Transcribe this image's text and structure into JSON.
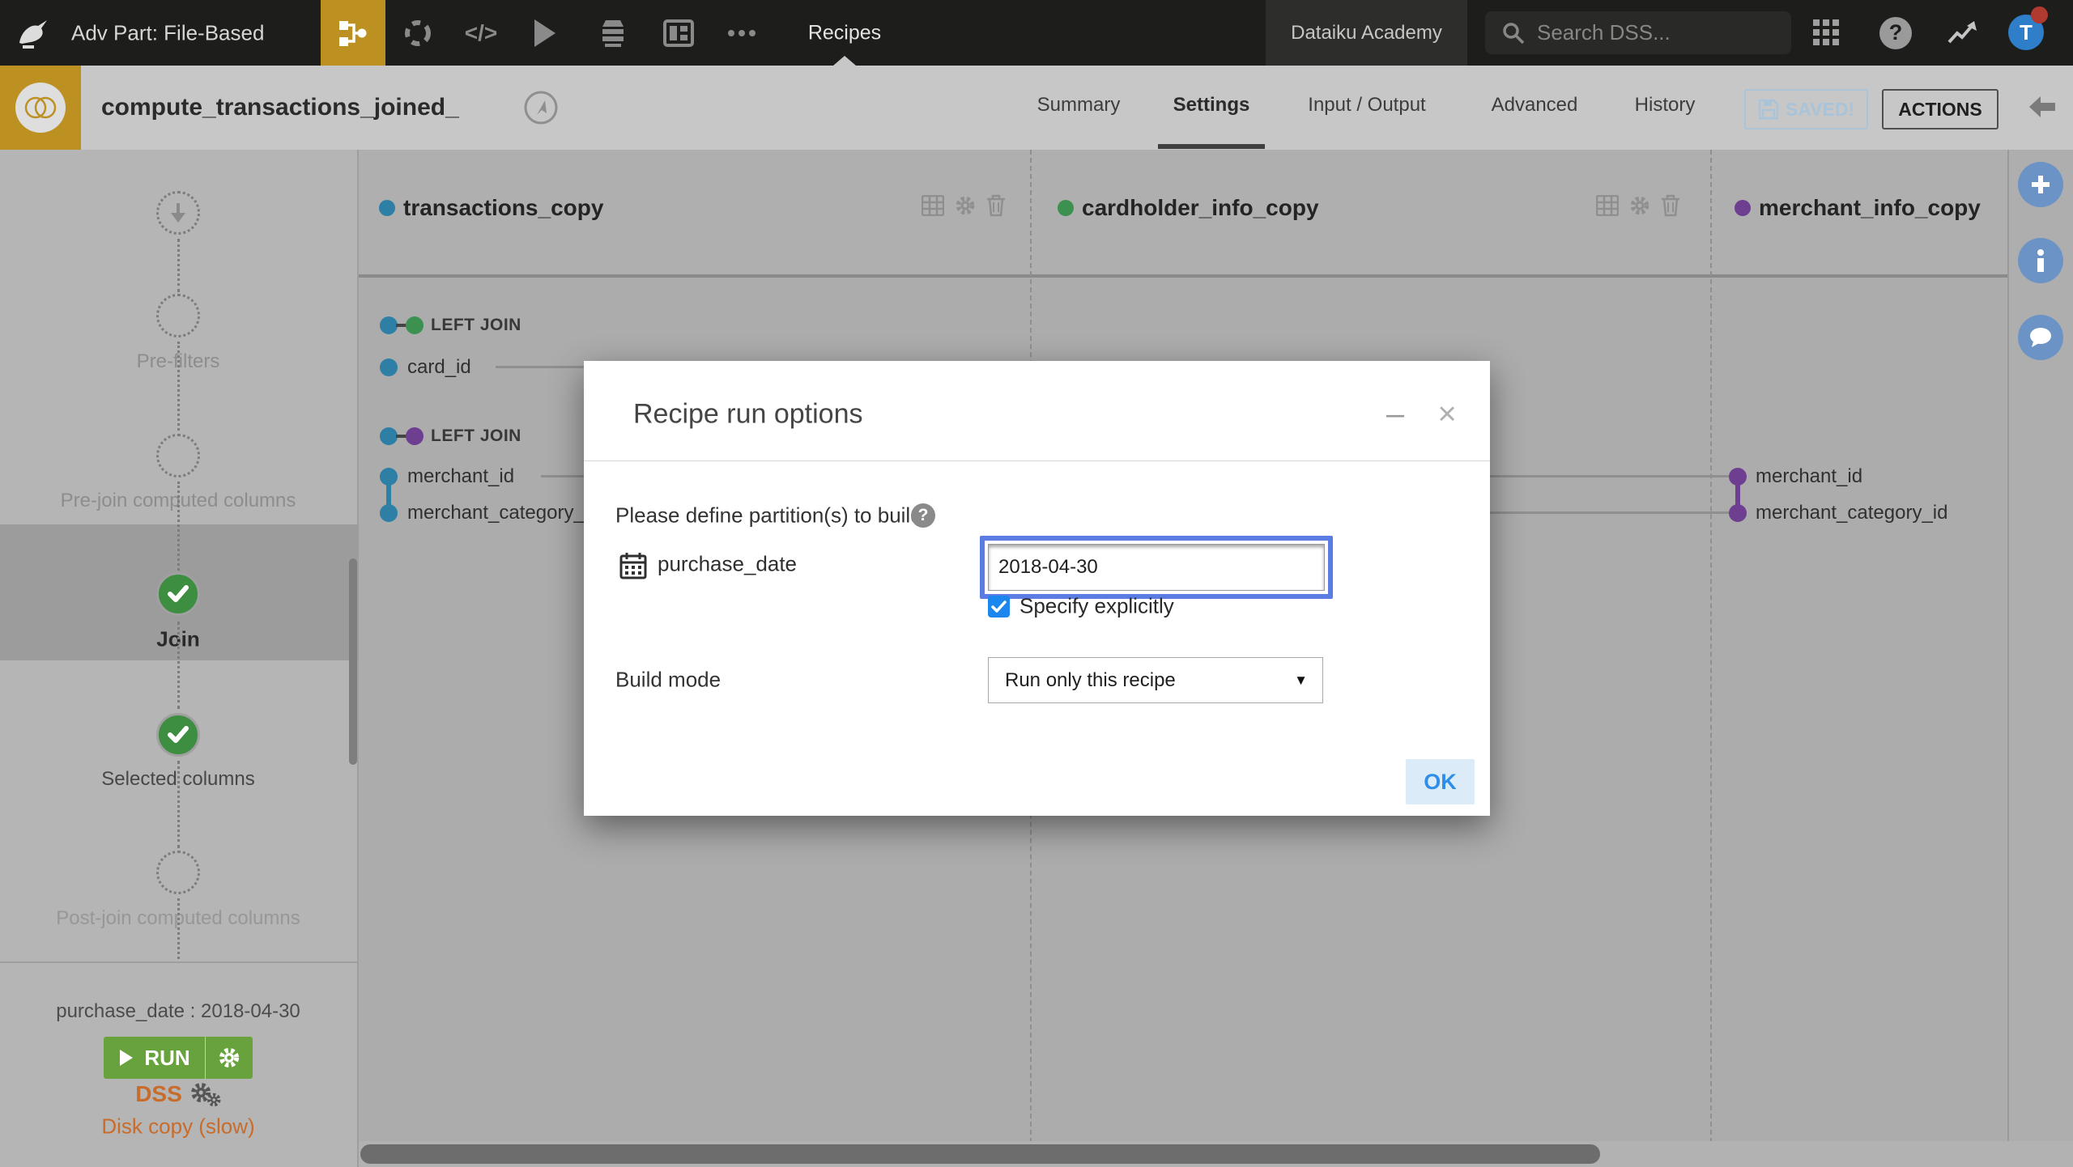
{
  "navbar": {
    "project_name": "Adv Part: File-Based",
    "section_label": "Recipes",
    "academy_label": "Dataiku Academy",
    "search_placeholder": "Search DSS...",
    "avatar_letter": "T"
  },
  "header": {
    "recipe_title": "compute_transactions_joined_",
    "tabs": [
      {
        "label": "Summary",
        "active": false
      },
      {
        "label": "Settings",
        "active": true
      },
      {
        "label": "Input / Output",
        "active": false
      },
      {
        "label": "Advanced",
        "active": false
      },
      {
        "label": "History",
        "active": false
      }
    ],
    "saved_label": "SAVED!",
    "actions_label": "ACTIONS"
  },
  "sidebar": {
    "steps": [
      {
        "label": "Pre-filters",
        "state": "pending"
      },
      {
        "label": "Pre-join computed columns",
        "state": "pending"
      },
      {
        "label": "Join",
        "state": "done",
        "selected": true
      },
      {
        "label": "Selected columns",
        "state": "done"
      },
      {
        "label": "Post-join computed columns",
        "state": "pending"
      }
    ],
    "partition_summary": "purchase_date : 2018-04-30",
    "run_label": "RUN",
    "engine_label": "DSS",
    "engine_detail": "Disk copy (slow)"
  },
  "datasets": [
    {
      "name": "transactions_copy",
      "color": "#2d7fa6"
    },
    {
      "name": "cardholder_info_copy",
      "color": "#3c9150"
    },
    {
      "name": "merchant_info_copy",
      "color": "#6e3f91"
    }
  ],
  "join_panel": {
    "joins": [
      {
        "label": "LEFT JOIN"
      },
      {
        "label": "LEFT JOIN"
      }
    ],
    "left_fields": [
      "card_id",
      "merchant_id",
      "merchant_category_"
    ],
    "right_fields": [
      "merchant_id",
      "merchant_category_id"
    ]
  },
  "modal": {
    "title": "Recipe run options",
    "minimize_label": "–",
    "close_label": "×",
    "partition_prompt": "Please define partition(s) to build",
    "help_glyph": "?",
    "partition_name": "purchase_date",
    "partition_value": "2018-04-30",
    "specify_label": "Specify explicitly",
    "build_mode_label": "Build mode",
    "build_mode_value": "Run only this recipe",
    "ok_label": "OK"
  },
  "colors": {
    "brand_gold": "#bd9022",
    "run_green": "#68a23c",
    "engine_orange": "#c86c2b",
    "focus_ring_blue": "#5b7ce2",
    "checkbox_blue": "#1b87ee",
    "ok_blue": "#2e8ee8",
    "dataset_teal": "#2d7fa6",
    "dataset_green": "#3c9150",
    "dataset_purple": "#6e3f91",
    "rail_button_blue": "#6b93c6",
    "step_done_green": "#3e8e41",
    "saved_blue": "#a9c3d8"
  }
}
